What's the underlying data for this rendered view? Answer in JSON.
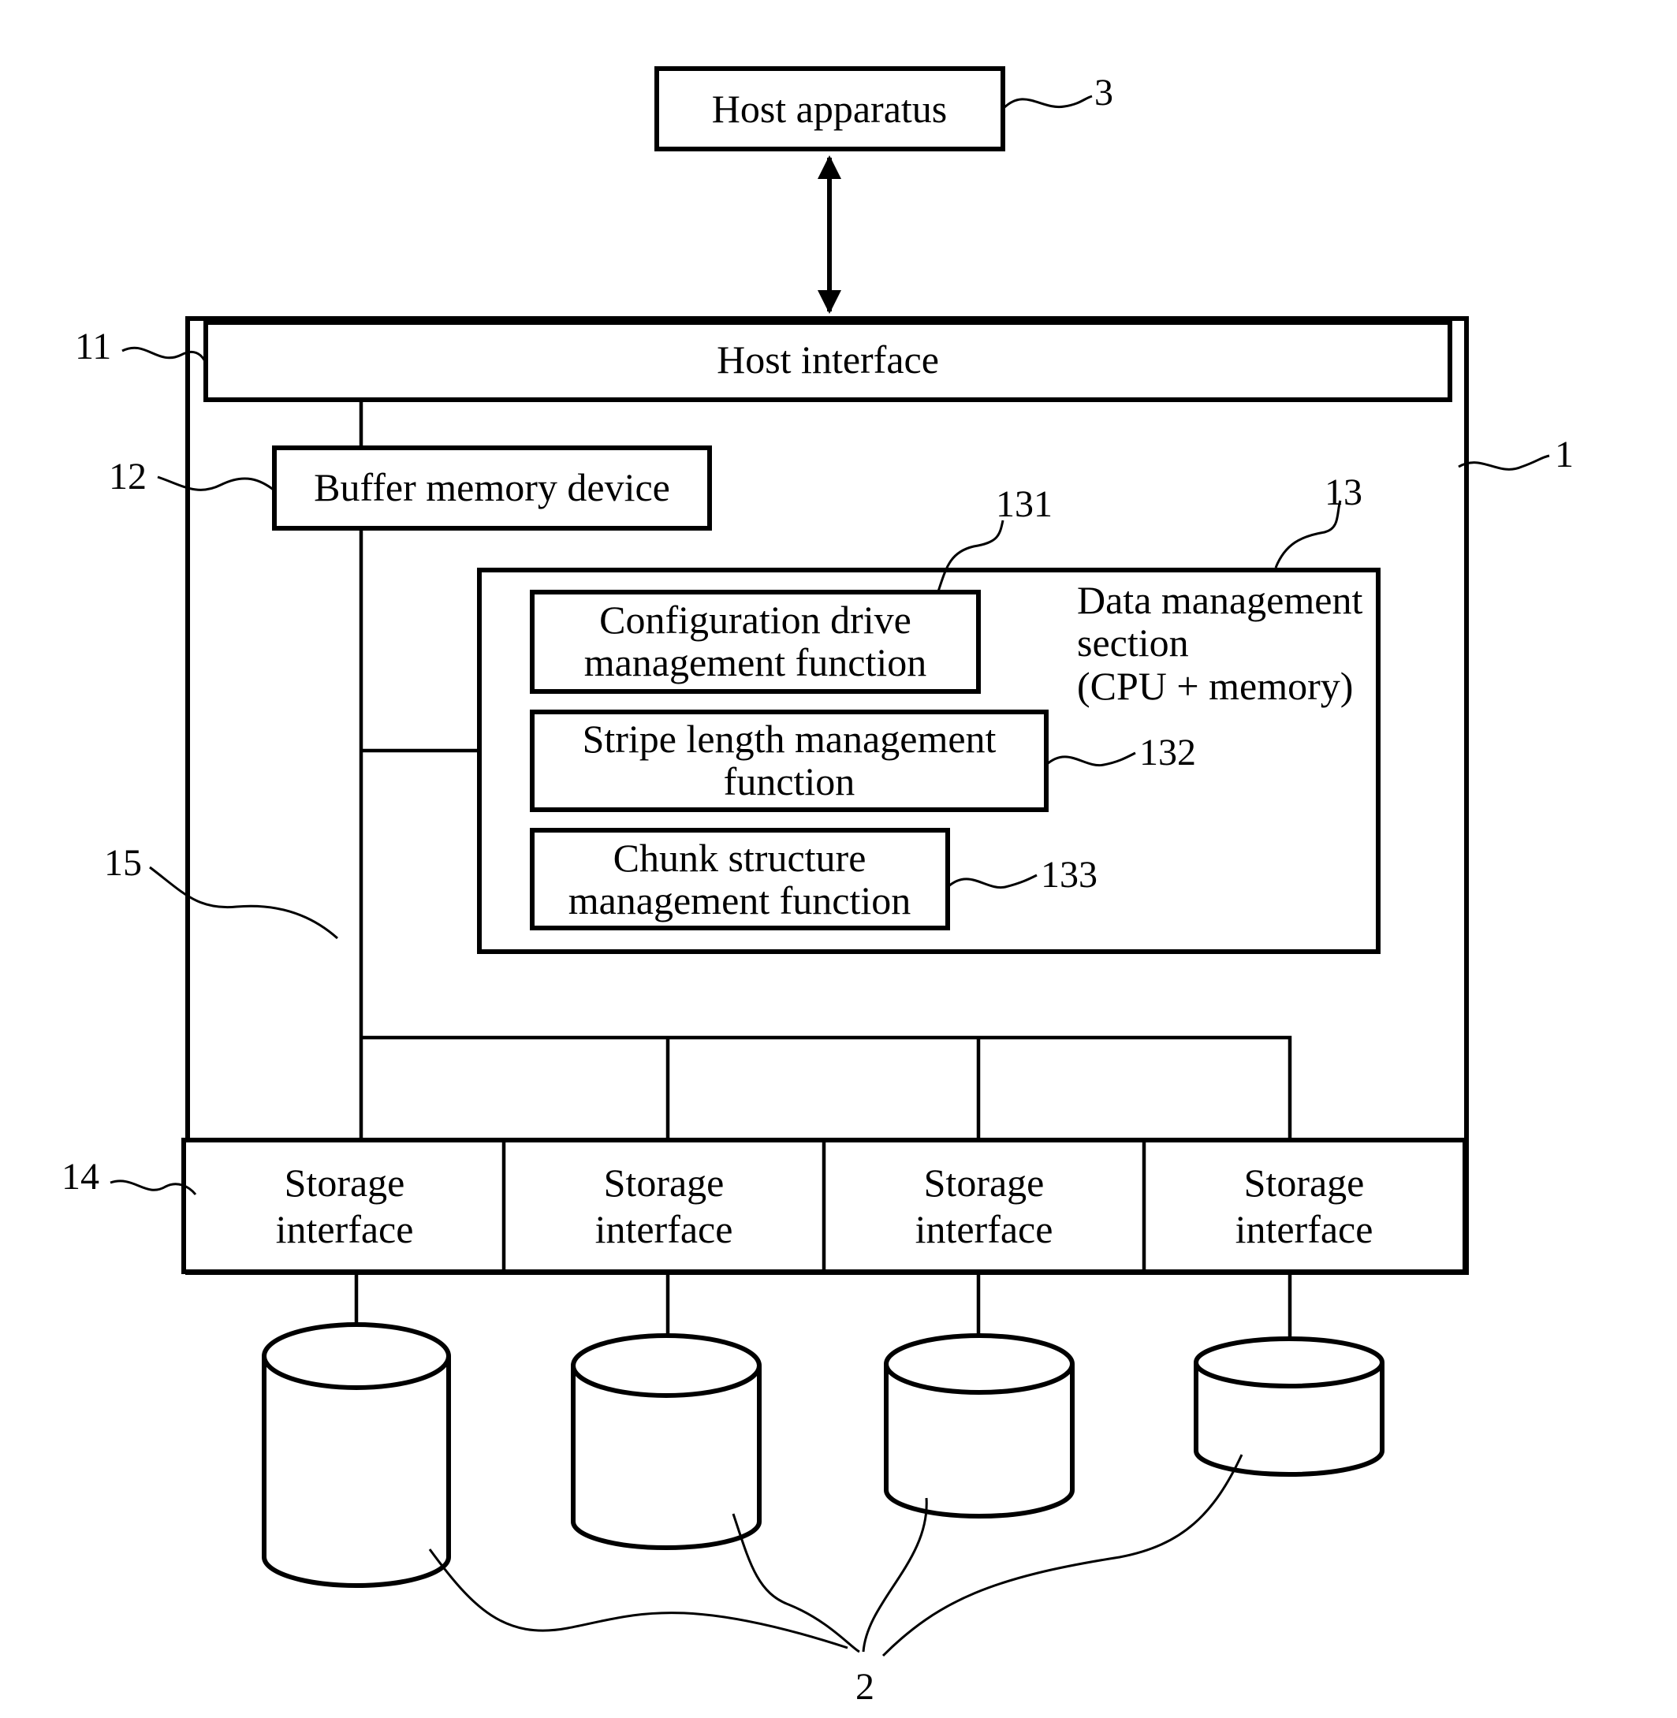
{
  "diagram": {
    "host_apparatus": {
      "label": "Host apparatus",
      "ref": "3"
    },
    "storage_controller": {
      "ref": "1"
    },
    "host_interface": {
      "label": "Host interface",
      "ref": "11"
    },
    "buffer_memory": {
      "label": "Buffer memory device",
      "ref": "12"
    },
    "data_management": {
      "label_lines": [
        "Data management",
        "section",
        "(CPU + memory)"
      ],
      "ref": "13",
      "functions": [
        {
          "lines": [
            "Configuration drive",
            "management function"
          ],
          "ref": "131"
        },
        {
          "lines": [
            "Stripe length management",
            "function"
          ],
          "ref": "132"
        },
        {
          "lines": [
            "Chunk structure",
            "management function"
          ],
          "ref": "133"
        }
      ]
    },
    "bus": {
      "ref": "15"
    },
    "storage_interfaces": {
      "ref": "14",
      "items": [
        {
          "lines": [
            "Storage",
            "interface"
          ]
        },
        {
          "lines": [
            "Storage",
            "interface"
          ]
        },
        {
          "lines": [
            "Storage",
            "interface"
          ]
        },
        {
          "lines": [
            "Storage",
            "interface"
          ]
        }
      ]
    },
    "storage_devices": {
      "ref": "2",
      "count": 4
    }
  }
}
